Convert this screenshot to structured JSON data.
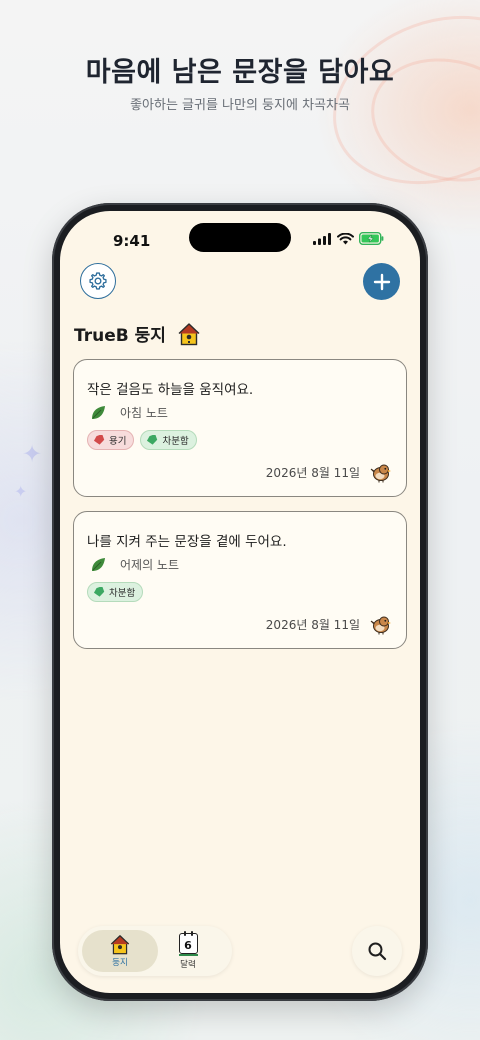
{
  "promo": {
    "headline": "마음에 남은 문장을 담아요",
    "subline": "좋아하는 글귀를 나만의 둥지에 차곡차곡"
  },
  "status_bar": {
    "time": "9:41",
    "icons": [
      "cellular-signal-icon",
      "wifi-icon",
      "battery-charging-icon"
    ]
  },
  "header": {
    "settings_icon": "gear-icon",
    "add_icon": "plus-icon"
  },
  "nest": {
    "title": "TrueB 둥지",
    "icon": "birdhouse-icon"
  },
  "cards": [
    {
      "quote": "작은 걸음도 하늘을 움직여요.",
      "note_icon": "leaf-icon",
      "note_name": "아침 노트",
      "tags": [
        {
          "label": "용기",
          "color": "red"
        },
        {
          "label": "차분함",
          "color": "green"
        }
      ],
      "date": "2026년 8월 11일",
      "avatar_icon": "bird-icon"
    },
    {
      "quote": "나를 지켜 주는 문장을 곁에 두어요.",
      "note_icon": "leaf-icon",
      "note_name": "어제의 노트",
      "tags": [
        {
          "label": "차분함",
          "color": "green"
        }
      ],
      "date": "2026년 8월 11일",
      "avatar_icon": "bird-icon"
    }
  ],
  "tabbar": {
    "tabs": [
      {
        "label": "둥지",
        "icon": "birdhouse-icon",
        "active": true
      },
      {
        "label": "달력",
        "icon": "calendar-icon",
        "day": "6",
        "active": false
      }
    ],
    "search_icon": "search-icon"
  },
  "colors": {
    "accent": "#2f72a3",
    "screen_bg": "#fdf6e8",
    "tag_red": "#f7dcdc",
    "tag_green": "#dcf1df"
  }
}
